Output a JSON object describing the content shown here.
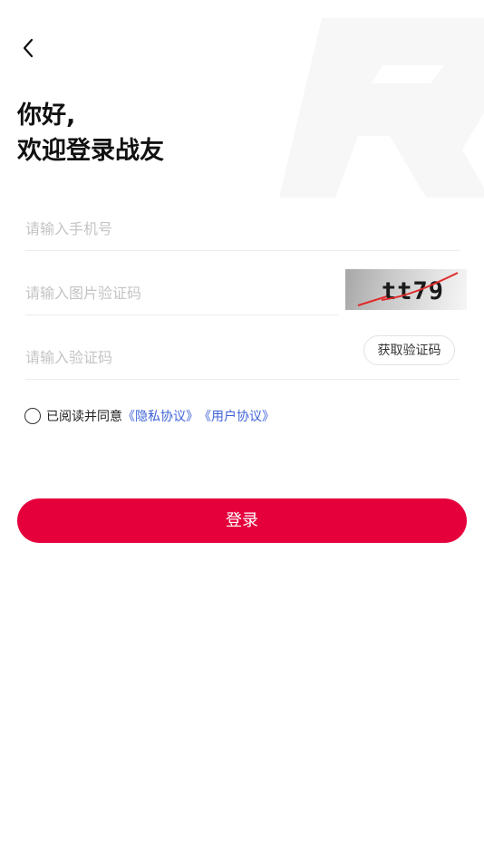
{
  "greeting": {
    "line1": "你好,",
    "line2": "欢迎登录战友"
  },
  "form": {
    "phone_placeholder": "请输入手机号",
    "captcha_placeholder": "请输入图片验证码",
    "captcha_image_text": "tt79",
    "code_placeholder": "请输入验证码",
    "get_code_label": "获取验证码"
  },
  "agreement": {
    "text": "已阅读并同意",
    "privacy_link": "《隐私协议》",
    "user_link": "《用户协议》",
    "checked": false
  },
  "login_button": "登录",
  "icons": {
    "back": "back-chevron-icon",
    "background": "r-logo-watermark"
  },
  "colors": {
    "primary": "#e5003c",
    "link": "#3f63d8",
    "placeholder": "#c4c4c4",
    "watermark": "#f7f7f7"
  }
}
